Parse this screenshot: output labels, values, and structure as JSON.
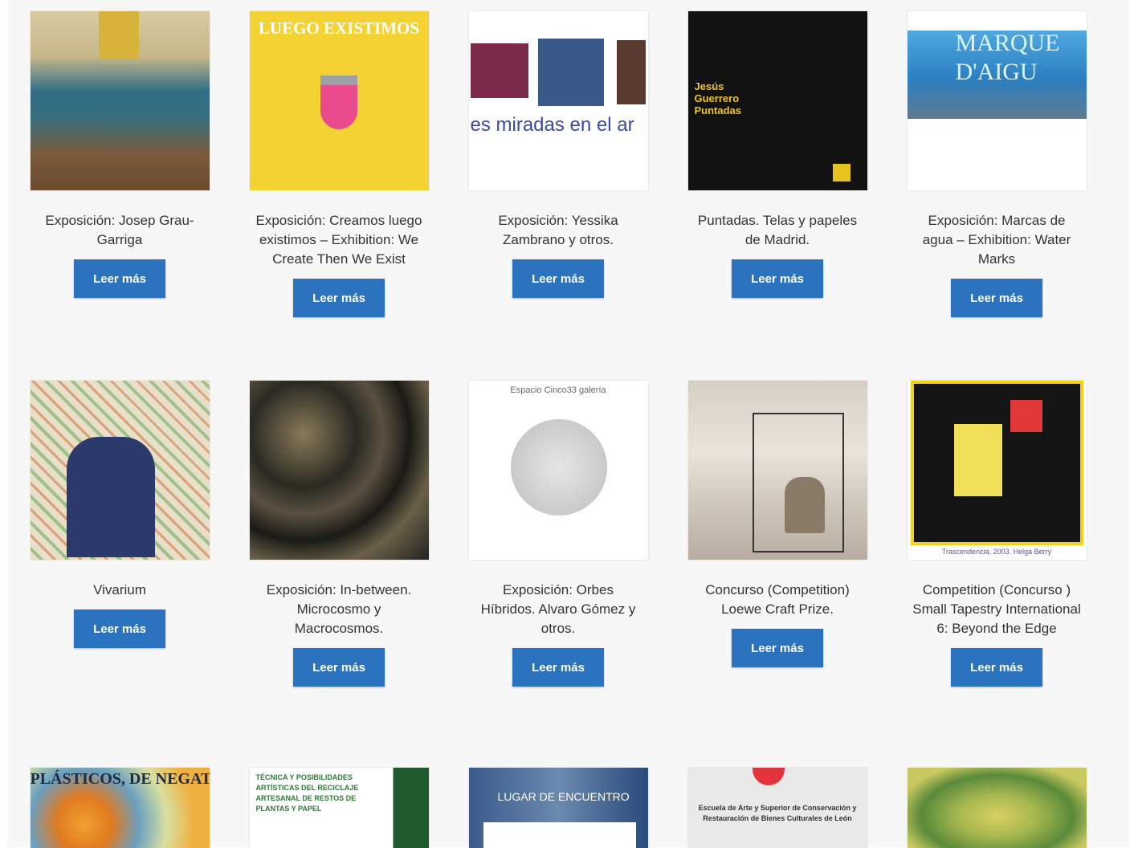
{
  "rows": [
    {
      "cards": [
        {
          "title": "Exposición: Josep Grau-Garriga",
          "button": "Leer más",
          "image_text": ""
        },
        {
          "title": "Exposición: Creamos luego existimos – Exhibition: We Create Then We Exist",
          "button": "Leer más",
          "image_text": "LUEGO EXISTIMOS"
        },
        {
          "title": "Exposición: Yessika Zambrano y otros.",
          "button": "Leer más",
          "image_text": "es miradas en el ar"
        },
        {
          "title": "Puntadas. Telas y papeles de Madrid.",
          "button": "Leer más",
          "image_text": "Jesús Guerrero Puntadas"
        },
        {
          "title": "Exposición: Marcas de agua – Exhibition: Water Marks",
          "button": "Leer más",
          "image_text": "MARQUE D'AIGU"
        }
      ]
    },
    {
      "cards": [
        {
          "title": "Vivarium",
          "button": "Leer más",
          "image_text": ""
        },
        {
          "title": "Exposición: In-between. Microcosmo y Macrocosmos.",
          "button": "Leer más",
          "image_text": ""
        },
        {
          "title": "Exposición: Orbes Híbridos. Alvaro Gómez y otros.",
          "button": "Leer más",
          "image_text": "Espacio Cinco33 galería"
        },
        {
          "title": "Concurso (Competition) Loewe Craft Prize.",
          "button": "Leer más",
          "image_text": ""
        },
        {
          "title": "Competition (Concurso ) Small Tapestry International 6: Beyond the Edge",
          "button": "Leer más",
          "image_text": "Trascendencia, 2003. Helga Berry"
        }
      ]
    },
    {
      "cards": [
        {
          "image_text": "PLÁSTICOS, DE NEGATIVO A POSITIVO"
        },
        {
          "image_text": "TÉCNICA Y POSIBILIDADES ARTÍSTICAS DEL RECICLAJE ARTESANAL DE RESTOS DE PLANTAS Y PAPEL"
        },
        {
          "image_text": "LUGAR DE ENCUENTRO"
        },
        {
          "image_text": "Escuela de Arte y Superior de Conservación y Restauración de Bienes Culturales de León"
        },
        {
          "image_text": ""
        }
      ]
    }
  ],
  "colors": {
    "button": "#2b72bf",
    "background": "#f7f7f7",
    "title": "#333333"
  }
}
